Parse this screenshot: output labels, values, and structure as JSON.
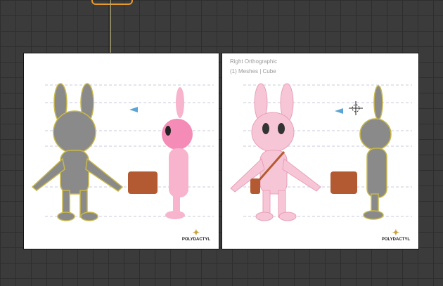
{
  "viewports": [
    {
      "name": "front",
      "label": "",
      "stats": ""
    },
    {
      "name": "right",
      "label": "Right Orthographic",
      "stats": "(1) Meshes | Cube"
    }
  ],
  "logo": {
    "text": "POLYDACTYL"
  },
  "colors": {
    "grid_bg": "#3b3b3b",
    "selection": "#e59a2c",
    "character_pink": "#f7c6d6",
    "bag": "#b35a32"
  }
}
